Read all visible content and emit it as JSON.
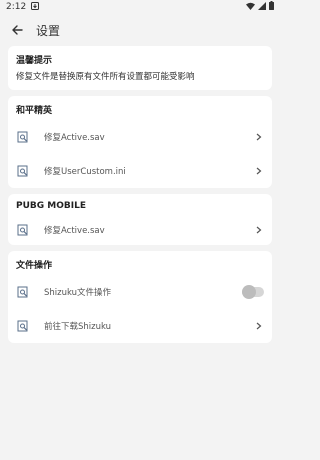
{
  "status": {
    "time": "2:12",
    "notification_icon": "download-icon",
    "wifi_icon": "wifi-icon",
    "signal_icon": "signal-icon",
    "battery_icon": "battery-icon"
  },
  "appbar": {
    "title": "设置",
    "back_icon": "arrow-back-icon"
  },
  "notice": {
    "title": "温馨提示",
    "text": "修复文件是替换原有文件所有设置都可能受影响"
  },
  "peace_elite": {
    "title": "和平精英",
    "items": [
      {
        "label": "修复Active.sav"
      },
      {
        "label": "修复UserCustom.ini"
      }
    ]
  },
  "pubg": {
    "title": "PUBG MOBILE",
    "items": [
      {
        "label": "修复Active.sav"
      }
    ]
  },
  "file_ops": {
    "title": "文件操作",
    "shizuku_toggle": {
      "label": "Shizuku文件操作",
      "enabled": false
    },
    "download_shizuku": {
      "label": "前往下载Shizuku"
    }
  },
  "colors": {
    "background": "#f3f3f3",
    "card": "#ffffff",
    "toggle_off": "#d6d6d6",
    "icon": "#5a6f8a"
  }
}
